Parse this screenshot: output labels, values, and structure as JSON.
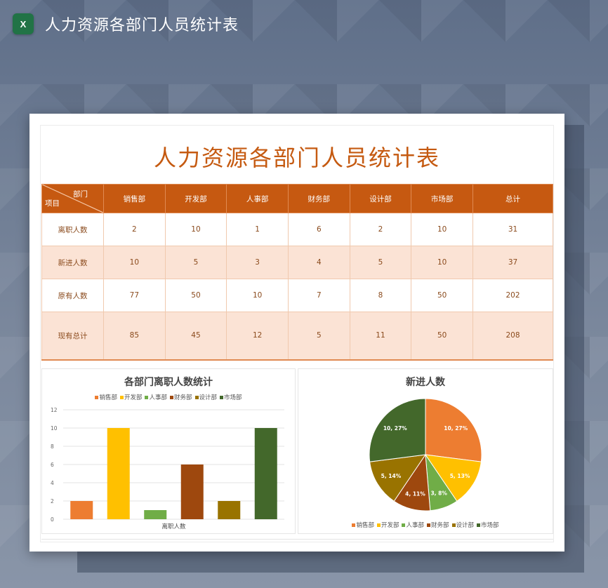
{
  "app": {
    "icon": "excel-icon",
    "icon_text": "X",
    "title": "人力资源各部门人员统计表"
  },
  "document": {
    "title": "人力资源各部门人员统计表"
  },
  "table": {
    "corner_top": "部门",
    "corner_bottom": "项目",
    "columns": [
      "销售部",
      "开发部",
      "人事部",
      "财务部",
      "设计部",
      "市场部",
      "总计"
    ],
    "rows": [
      {
        "label": "离职人数",
        "values": [
          "2",
          "10",
          "1",
          "6",
          "2",
          "10",
          "31"
        ]
      },
      {
        "label": "新进人数",
        "values": [
          "10",
          "5",
          "3",
          "4",
          "5",
          "10",
          "37"
        ]
      },
      {
        "label": "原有人数",
        "values": [
          "77",
          "50",
          "10",
          "7",
          "8",
          "50",
          "202"
        ]
      },
      {
        "label": "现有总计",
        "values": [
          "85",
          "45",
          "12",
          "5",
          "11",
          "50",
          "208"
        ]
      }
    ]
  },
  "colors": {
    "销售部": "#ed7d31",
    "开发部": "#ffc000",
    "人事部": "#70ad47",
    "财务部": "#9e480e",
    "设计部": "#997300",
    "市场部": "#43682b"
  },
  "chart_data": [
    {
      "type": "bar",
      "title": "各部门离职人数统计",
      "categories": [
        "离职人数"
      ],
      "xlabel": "离职人数",
      "series": [
        {
          "name": "销售部",
          "values": [
            2
          ]
        },
        {
          "name": "开发部",
          "values": [
            10
          ]
        },
        {
          "name": "人事部",
          "values": [
            1
          ]
        },
        {
          "name": "财务部",
          "values": [
            6
          ]
        },
        {
          "name": "设计部",
          "values": [
            2
          ]
        },
        {
          "name": "市场部",
          "values": [
            10
          ]
        }
      ],
      "ylim": [
        0,
        12
      ],
      "yticks": [
        0,
        2,
        4,
        6,
        8,
        10,
        12
      ],
      "grid": true,
      "legend": "top"
    },
    {
      "type": "pie",
      "title": "新进人数",
      "labels": [
        "销售部",
        "开发部",
        "人事部",
        "财务部",
        "设计部",
        "市场部"
      ],
      "values": [
        10,
        5,
        3,
        4,
        5,
        10
      ],
      "data_labels": [
        "10, 27%",
        "5, 13%",
        "3, 8%",
        "4, 11%",
        "5, 14%",
        "10, 27%"
      ],
      "legend": "bottom"
    }
  ]
}
